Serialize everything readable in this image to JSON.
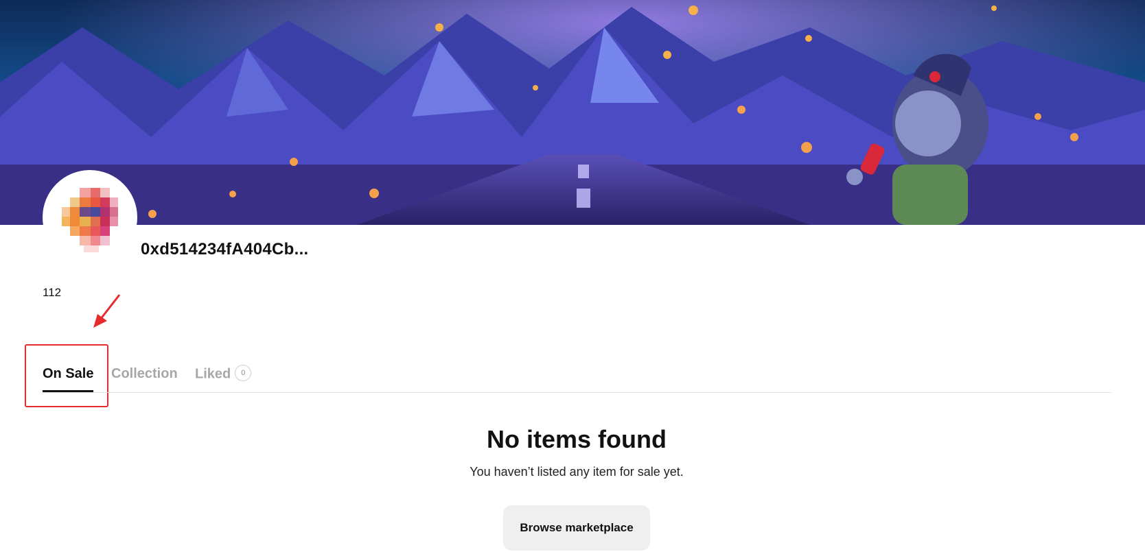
{
  "profile": {
    "address": "0xd514234fA404Cb...",
    "count": "112"
  },
  "tabs": [
    {
      "label": "On Sale",
      "active": true
    },
    {
      "label": "Collection",
      "active": false
    },
    {
      "label": "Liked",
      "badge": "0",
      "active": false
    }
  ],
  "empty_state": {
    "title": "No items found",
    "subtitle": "You haven’t listed any item for sale yet.",
    "button_label": "Browse marketplace"
  },
  "colors": {
    "annotation": "#e52b2b",
    "active_tab": "#111111",
    "inactive_tab": "#a7a7a7",
    "button_bg": "#efefef"
  }
}
